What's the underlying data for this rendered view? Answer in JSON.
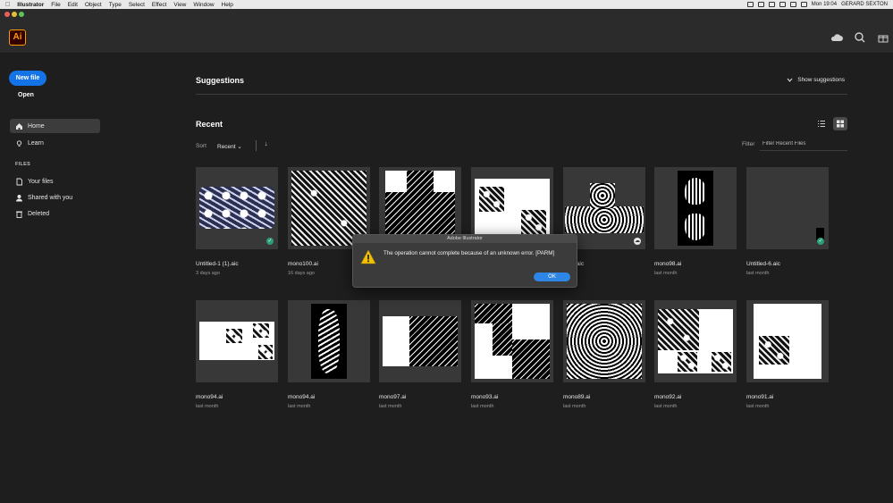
{
  "menubar": {
    "apple": "",
    "app": "Illustrator",
    "items": [
      "File",
      "Edit",
      "Object",
      "Type",
      "Select",
      "Effect",
      "View",
      "Window",
      "Help"
    ],
    "clock": "Mon 19:04",
    "user": "GERARD SEXTON"
  },
  "app": {
    "logo": "Ai",
    "icons": [
      "cloud-icon",
      "search-icon",
      "gift-icon"
    ]
  },
  "sidebar": {
    "new_file": "New file",
    "open": "Open",
    "nav": [
      {
        "label": "Home",
        "icon": "home-icon"
      },
      {
        "label": "Learn",
        "icon": "lightbulb-icon"
      }
    ],
    "files_heading": "FILES",
    "files": [
      {
        "label": "Your files",
        "icon": "file-icon"
      },
      {
        "label": "Shared with you",
        "icon": "users-icon"
      },
      {
        "label": "Deleted",
        "icon": "trash-icon"
      }
    ]
  },
  "suggestions": {
    "title": "Suggestions",
    "toggle": "Show suggestions"
  },
  "recent": {
    "title": "Recent",
    "sort_label": "Sort",
    "sort_value": "Recent",
    "filter_label": "Filter",
    "filter_placeholder": "Filter Recent Files",
    "files": [
      {
        "name": "Untitled-1 (1).aic",
        "date": "3 days ago",
        "status": "synced"
      },
      {
        "name": "mono100.ai",
        "date": "16 days ago",
        "status": ""
      },
      {
        "name": "",
        "date": "",
        "status": ""
      },
      {
        "name": "",
        "date": "",
        "status": ""
      },
      {
        "name": "ed-8.aic",
        "date": "s ago",
        "status": "cloud"
      },
      {
        "name": "mono98.ai",
        "date": "last month",
        "status": ""
      },
      {
        "name": "Untitled-6.aic",
        "date": "last month",
        "status": "synced"
      },
      {
        "name": "mono94.ai",
        "date": "last month",
        "status": ""
      },
      {
        "name": "mono94.ai",
        "date": "last month",
        "status": ""
      },
      {
        "name": "mono97.ai",
        "date": "last month",
        "status": ""
      },
      {
        "name": "mono93.ai",
        "date": "last month",
        "status": ""
      },
      {
        "name": "mono89.ai",
        "date": "last month",
        "status": ""
      },
      {
        "name": "mono92.ai",
        "date": "last month",
        "status": ""
      },
      {
        "name": "mono91.ai",
        "date": "last month",
        "status": ""
      }
    ]
  },
  "dialog": {
    "title": "Adobe Illustrator",
    "message": "The operation cannot complete because of an unknown error.   [PARM]",
    "ok": "OK"
  }
}
